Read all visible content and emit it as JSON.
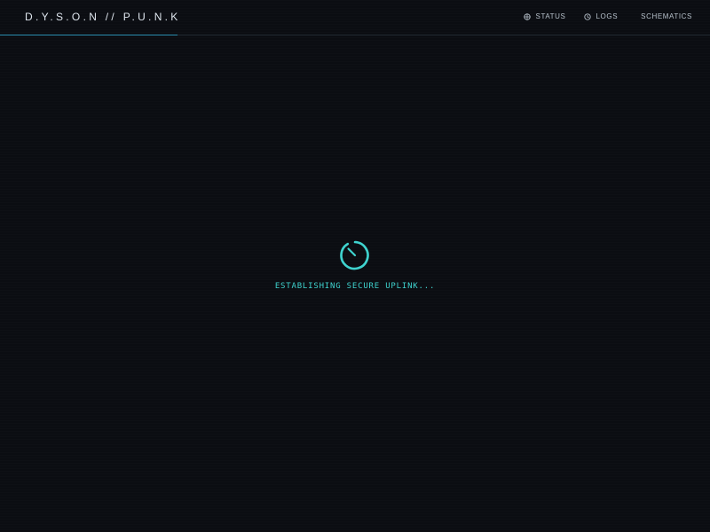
{
  "brand": {
    "title": "D.Y.S.O.N // P.U.N.K"
  },
  "nav": {
    "items": [
      {
        "label": "STATUS",
        "icon": "crosshair-icon"
      },
      {
        "label": "LOGS",
        "icon": "clock-icon"
      },
      {
        "label": "SCHEMATICS",
        "icon": null
      }
    ]
  },
  "loader": {
    "text": "ESTABLISHING SECURE UPLINK..."
  },
  "colors": {
    "background": "#0b0d12",
    "accent": "#3fd3cf",
    "brand_line": "#2a8fb0",
    "divider": "#232a33"
  }
}
